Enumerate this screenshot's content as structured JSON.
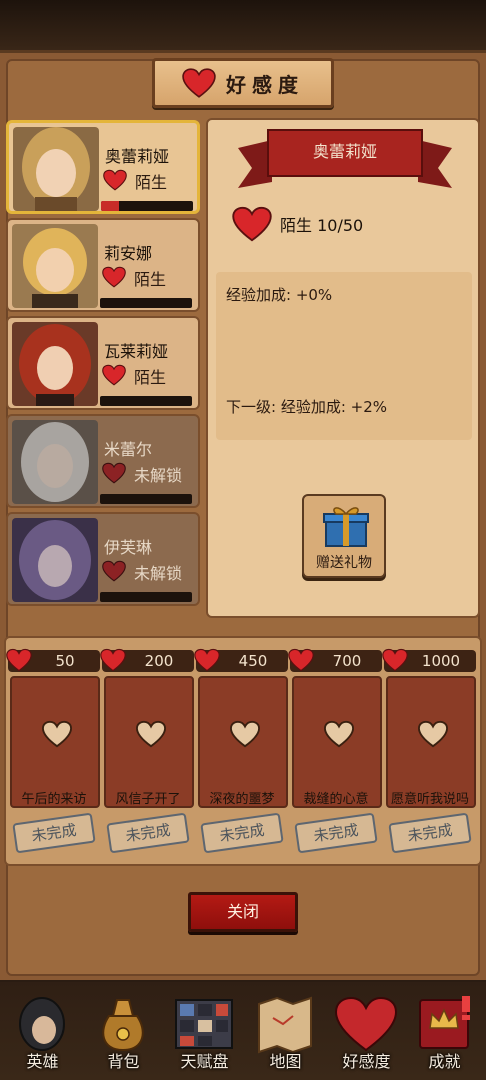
{
  "header": {
    "title": "好感度"
  },
  "heroes": [
    {
      "name": "奥蕾莉娅",
      "status": "陌生",
      "progress": 0.2,
      "selected": true,
      "locked": false
    },
    {
      "name": "莉安娜",
      "status": "陌生",
      "progress": 0,
      "selected": false,
      "locked": false
    },
    {
      "name": "瓦莱莉娅",
      "status": "陌生",
      "progress": 0,
      "selected": false,
      "locked": false
    },
    {
      "name": "米蕾尔",
      "status": "未解锁",
      "progress": 0,
      "selected": false,
      "locked": true
    },
    {
      "name": "伊芙琳",
      "status": "未解锁",
      "progress": 0,
      "selected": false,
      "locked": true
    }
  ],
  "detail": {
    "name": "奥蕾莉娅",
    "affection_line": "陌生 10/50",
    "bonus_current": "经验加成: +0%",
    "bonus_next": "下一级: 经验加成: +2%",
    "gift_label": "赠送礼物"
  },
  "rewards": [
    {
      "cost": "50",
      "name": "午后的来访",
      "status": "未完成"
    },
    {
      "cost": "200",
      "name": "风信子开了",
      "status": "未完成"
    },
    {
      "cost": "450",
      "name": "深夜的噩梦",
      "status": "未完成"
    },
    {
      "cost": "700",
      "name": "裁缝的心意",
      "status": "未完成"
    },
    {
      "cost": "1000",
      "name": "愿意听我说吗",
      "status": "未完成"
    }
  ],
  "close_label": "关闭",
  "nav": [
    {
      "label": "英雄",
      "icon": "hero-icon"
    },
    {
      "label": "背包",
      "icon": "bag-icon"
    },
    {
      "label": "天赋盘",
      "icon": "talent-icon"
    },
    {
      "label": "地图",
      "icon": "map-icon"
    },
    {
      "label": "好感度",
      "icon": "heart-icon"
    },
    {
      "label": "成就",
      "icon": "achievement-icon"
    }
  ],
  "colors": {
    "heart": "#d8262a",
    "accent": "#e4b53a",
    "button": "#b41a14"
  }
}
